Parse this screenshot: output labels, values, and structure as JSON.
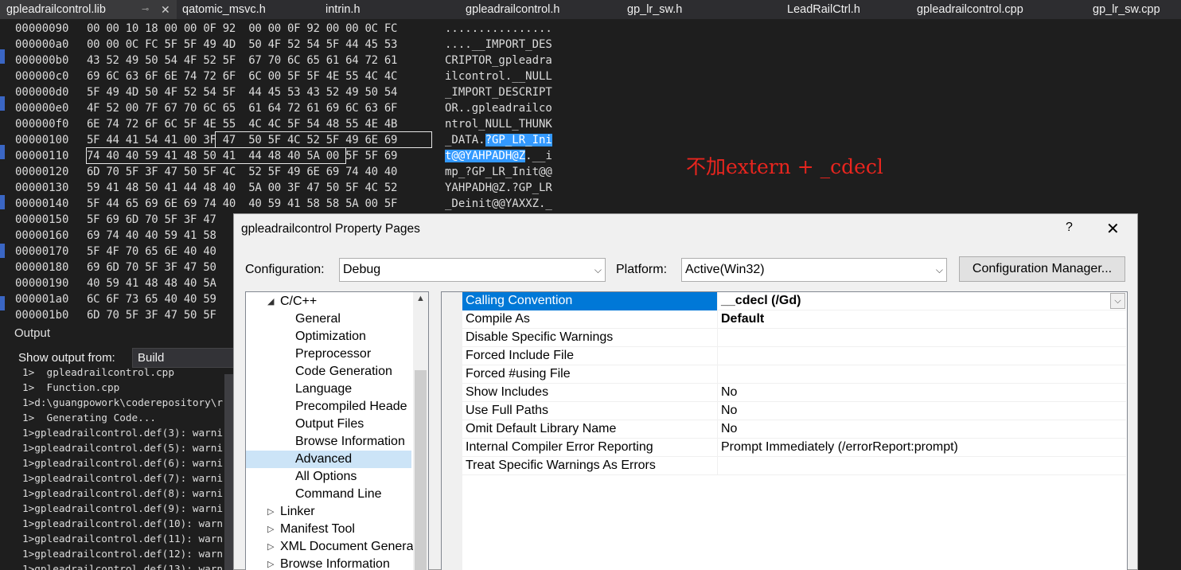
{
  "tabs": [
    {
      "label": "gpleadrailcontrol.lib",
      "active": true
    },
    {
      "label": "qatomic_msvc.h"
    },
    {
      "label": "intrin.h"
    },
    {
      "label": "gpleadrailcontrol.h"
    },
    {
      "label": "gp_lr_sw.h"
    },
    {
      "label": "LeadRailCtrl.h"
    },
    {
      "label": "gpleadrailcontrol.cpp"
    },
    {
      "label": "gp_lr_sw.cpp"
    }
  ],
  "tab_icons": {
    "pin": "⊸",
    "close": "✕"
  },
  "hex": {
    "rows": [
      {
        "addr": "00000090",
        "bytes": "00 00 10 18 00 00 0F 92  00 00 0F 92 00 00 0C FC",
        "ascii": "................"
      },
      {
        "addr": "000000a0",
        "bytes": "00 00 0C FC 5F 5F 49 4D  50 4F 52 54 5F 44 45 53",
        "ascii": "....__IMPORT_DES"
      },
      {
        "addr": "000000b0",
        "bytes": "43 52 49 50 54 4F 52 5F  67 70 6C 65 61 64 72 61",
        "ascii": "CRIPTOR_gpleadra"
      },
      {
        "addr": "000000c0",
        "bytes": "69 6C 63 6F 6E 74 72 6F  6C 00 5F 5F 4E 55 4C 4C",
        "ascii": "ilcontrol.__NULL"
      },
      {
        "addr": "000000d0",
        "bytes": "5F 49 4D 50 4F 52 54 5F  44 45 53 43 52 49 50 54",
        "ascii": "_IMPORT_DESCRIPT"
      },
      {
        "addr": "000000e0",
        "bytes": "4F 52 00 7F 67 70 6C 65  61 64 72 61 69 6C 63 6F",
        "ascii": "OR..gpleadrailco"
      },
      {
        "addr": "000000f0",
        "bytes": "6E 74 72 6F 6C 5F 4E 55  4C 4C 5F 54 48 55 4E 4B",
        "ascii": "ntrol_NULL_THUNK"
      },
      {
        "addr": "00000100",
        "bytes": "5F 44 41 54 41 00 3F 47  50 5F 4C 52 5F 49 6E 69",
        "ascii_plain": "_DATA.",
        "ascii_hl": "?GP_LR_Ini"
      },
      {
        "addr": "00000110",
        "bytes": "74 40 40 59 41 48 50 41  44 48 40 5A 00 5F 5F 69",
        "ascii_hl": "t@@YAHPADH@Z",
        "ascii_plain": ".__i"
      },
      {
        "addr": "00000120",
        "bytes": "6D 70 5F 3F 47 50 5F 4C  52 5F 49 6E 69 74 40 40",
        "ascii": "mp_?GP_LR_Init@@"
      },
      {
        "addr": "00000130",
        "bytes": "59 41 48 50 41 44 48 40  5A 00 3F 47 50 5F 4C 52",
        "ascii": "YAHPADH@Z.?GP_LR"
      },
      {
        "addr": "00000140",
        "bytes": "5F 44 65 69 6E 69 74 40  40 59 41 58 58 5A 00 5F",
        "ascii": "_Deinit@@YAXXZ._"
      },
      {
        "addr": "00000150",
        "bytes": "5F 69 6D 70 5F 3F 47",
        "ascii": ""
      },
      {
        "addr": "00000160",
        "bytes": "69 74 40 40 59 41 58",
        "ascii": ""
      },
      {
        "addr": "00000170",
        "bytes": "5F 4F 70 65 6E 40 40",
        "ascii": ""
      },
      {
        "addr": "00000180",
        "bytes": "69 6D 70 5F 3F 47 50",
        "ascii": ""
      },
      {
        "addr": "00000190",
        "bytes": "40 59 41 48 48 40 5A",
        "ascii": ""
      },
      {
        "addr": "000001a0",
        "bytes": "6C 6F 73 65 40 40 59",
        "ascii": ""
      },
      {
        "addr": "000001b0",
        "bytes": "6D 70 5F 3F 47 50 5F",
        "ascii": ""
      }
    ]
  },
  "annotation": "不加extern + _cdecl",
  "output": {
    "title": "Output",
    "show_from_label": "Show output from:",
    "show_from_value": "Build",
    "lines": [
      "1>  gpleadrailcontrol.cpp",
      "1>  Function.cpp",
      "1>d:\\guangpowork\\coderepository\\r",
      "1>  Generating Code...",
      "1>gpleadrailcontrol.def(3): warni",
      "1>gpleadrailcontrol.def(5): warni",
      "1>gpleadrailcontrol.def(6): warni",
      "1>gpleadrailcontrol.def(7): warni",
      "1>gpleadrailcontrol.def(8): warni",
      "1>gpleadrailcontrol.def(9): warni",
      "1>gpleadrailcontrol.def(10): warn",
      "1>gpleadrailcontrol.def(11): warn",
      "1>gpleadrailcontrol.def(12): warn",
      "1>gpleadrailcontrol.def(13): warn"
    ]
  },
  "dialog": {
    "title": "gpleadrailcontrol Property Pages",
    "help": "?",
    "close": "✕",
    "configuration_label": "Configuration:",
    "configuration_value": "Debug",
    "platform_label": "Platform:",
    "platform_value": "Active(Win32)",
    "config_manager_button": "Configuration Manager...",
    "tree": [
      {
        "label": "C/C++",
        "level": 0,
        "expander": "◢"
      },
      {
        "label": "General",
        "level": 1
      },
      {
        "label": "Optimization",
        "level": 1
      },
      {
        "label": "Preprocessor",
        "level": 1
      },
      {
        "label": "Code Generation",
        "level": 1
      },
      {
        "label": "Language",
        "level": 1
      },
      {
        "label": "Precompiled Heade",
        "level": 1
      },
      {
        "label": "Output Files",
        "level": 1
      },
      {
        "label": "Browse Information",
        "level": 1
      },
      {
        "label": "Advanced",
        "level": 1,
        "selected": true
      },
      {
        "label": "All Options",
        "level": 1
      },
      {
        "label": "Command Line",
        "level": 1
      },
      {
        "label": "Linker",
        "level": 0,
        "expander": "▷"
      },
      {
        "label": "Manifest Tool",
        "level": 0,
        "expander": "▷"
      },
      {
        "label": "XML Document Genera",
        "level": 0,
        "expander": "▷"
      },
      {
        "label": "Browse Information",
        "level": 0,
        "expander": "▷"
      }
    ],
    "properties": [
      {
        "name": "Calling Convention",
        "value": "__cdecl (/Gd)",
        "selected": true,
        "bold": true
      },
      {
        "name": "Compile As",
        "value": "Default",
        "bold": true
      },
      {
        "name": "Disable Specific Warnings",
        "value": ""
      },
      {
        "name": "Forced Include File",
        "value": ""
      },
      {
        "name": "Forced #using File",
        "value": ""
      },
      {
        "name": "Show Includes",
        "value": "No"
      },
      {
        "name": "Use Full Paths",
        "value": "No"
      },
      {
        "name": "Omit Default Library Name",
        "value": "No"
      },
      {
        "name": "Internal Compiler Error Reporting",
        "value": "Prompt Immediately (/errorReport:prompt)"
      },
      {
        "name": "Treat Specific Warnings As Errors",
        "value": ""
      }
    ]
  },
  "icons": {
    "dropdown": "chevron-down-icon",
    "tree_scroll_up": "▲"
  },
  "colors": {
    "selection_blue": "#0078d7",
    "hex_highlight": "#3399ff",
    "annotation_red": "#e8251e",
    "tree_selected": "#cce4f7"
  }
}
